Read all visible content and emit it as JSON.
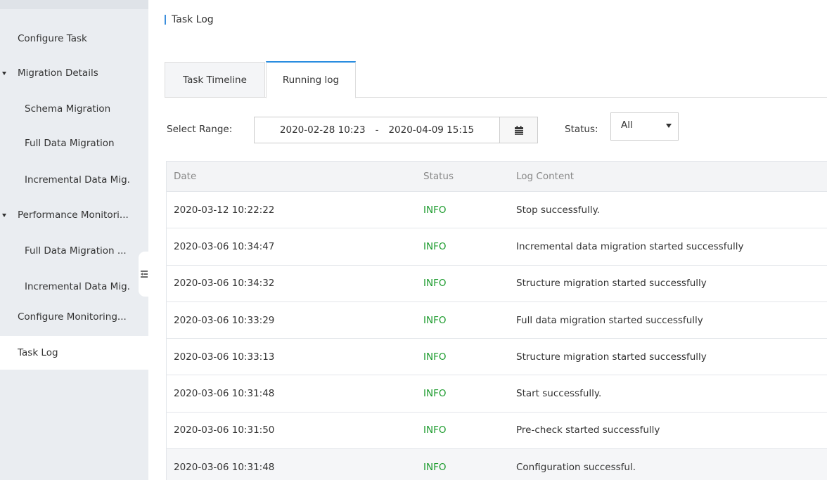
{
  "sidebar": {
    "items": [
      {
        "label": "Configure Task",
        "level": 1
      },
      {
        "label": "Migration Details",
        "level": 1,
        "expandable": true
      },
      {
        "label": "Schema Migration",
        "level": 2
      },
      {
        "label": "Full Data Migration",
        "level": 2
      },
      {
        "label": "Incremental Data Mig.",
        "level": 2
      },
      {
        "label": "Performance Monitori...",
        "level": 1,
        "expandable": true
      },
      {
        "label": "Full Data Migration ...",
        "level": 2
      },
      {
        "label": "Incremental Data Mig.",
        "level": 2
      },
      {
        "label": "Configure Monitoring...",
        "level": 1
      },
      {
        "label": "Task Log",
        "level": 1,
        "active": true
      }
    ]
  },
  "page": {
    "title": "Task Log"
  },
  "tabs": [
    {
      "label": "Task Timeline",
      "active": false
    },
    {
      "label": "Running log",
      "active": true
    }
  ],
  "filters": {
    "range_label": "Select Range:",
    "range_start": "2020-02-28 10:23",
    "range_sep": "-",
    "range_end": "2020-04-09 15:15",
    "status_label": "Status:",
    "status_value": "All"
  },
  "table": {
    "headers": {
      "date": "Date",
      "status": "Status",
      "log": "Log Content"
    },
    "rows": [
      {
        "date": "2020-03-12 10:22:22",
        "status": "INFO",
        "log": "Stop successfully."
      },
      {
        "date": "2020-03-06 10:34:47",
        "status": "INFO",
        "log": "Incremental data migration started successfully"
      },
      {
        "date": "2020-03-06 10:34:32",
        "status": "INFO",
        "log": "Structure migration started successfully"
      },
      {
        "date": "2020-03-06 10:33:29",
        "status": "INFO",
        "log": "Full data migration started successfully"
      },
      {
        "date": "2020-03-06 10:33:13",
        "status": "INFO",
        "log": "Structure migration started successfully"
      },
      {
        "date": "2020-03-06 10:31:48",
        "status": "INFO",
        "log": "Start successfully."
      },
      {
        "date": "2020-03-06 10:31:50",
        "status": "INFO",
        "log": "Pre-check started successfully"
      },
      {
        "date": "2020-03-06 10:31:48",
        "status": "INFO",
        "log": "Configuration successful."
      }
    ]
  },
  "colors": {
    "accent": "#2a8de0",
    "info": "#1a9a2b",
    "sidebar_bg": "#eaedf1"
  },
  "icons": {
    "calendar": "calendar-icon",
    "collapse": "collapse-sidebar-icon",
    "dropdown": "caret-down-icon"
  }
}
